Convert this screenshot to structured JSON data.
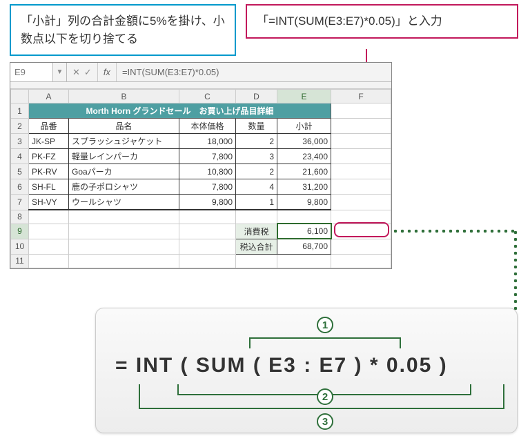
{
  "callout_blue": "「小計」列の合計金額に5%を掛け、小数点以下を切り捨てる",
  "callout_magenta": "「=INT(SUM(E3:E7)*0.05)」と入力",
  "namebox": "E9",
  "fx_symbol": "fx",
  "formula_bar": "=INT(SUM(E3:E7)*0.05)",
  "cols": [
    "A",
    "B",
    "C",
    "D",
    "E",
    "F"
  ],
  "title_merged": "Morth Horn グランドセール　お買い上げ品目詳細",
  "headers": {
    "a": "品番",
    "b": "品名",
    "c": "本体価格",
    "d": "数量",
    "e": "小計"
  },
  "rows": [
    {
      "a": "JK-SP",
      "b": "スプラッシュジャケット",
      "c": "18,000",
      "d": "2",
      "e": "36,000"
    },
    {
      "a": "PK-FZ",
      "b": "軽量レインパーカ",
      "c": "7,800",
      "d": "3",
      "e": "23,400"
    },
    {
      "a": "PK-RV",
      "b": "Goaパーカ",
      "c": "10,800",
      "d": "2",
      "e": "21,600"
    },
    {
      "a": "SH-FL",
      "b": "鹿の子ポロシャツ",
      "c": "7,800",
      "d": "4",
      "e": "31,200"
    },
    {
      "a": "SH-VY",
      "b": "ウールシャツ",
      "c": "9,800",
      "d": "1",
      "e": "9,800"
    }
  ],
  "tax": {
    "label": "消費税",
    "value": "6,100"
  },
  "total": {
    "label": "税込合計",
    "value": "68,700"
  },
  "row_nums": [
    "1",
    "2",
    "3",
    "4",
    "5",
    "6",
    "7",
    "8",
    "9",
    "10",
    "11"
  ],
  "formula_display": "= INT ( SUM ( E3 : E7 ) * 0.05 )",
  "badge1": "1",
  "badge2": "2",
  "badge3": "3"
}
